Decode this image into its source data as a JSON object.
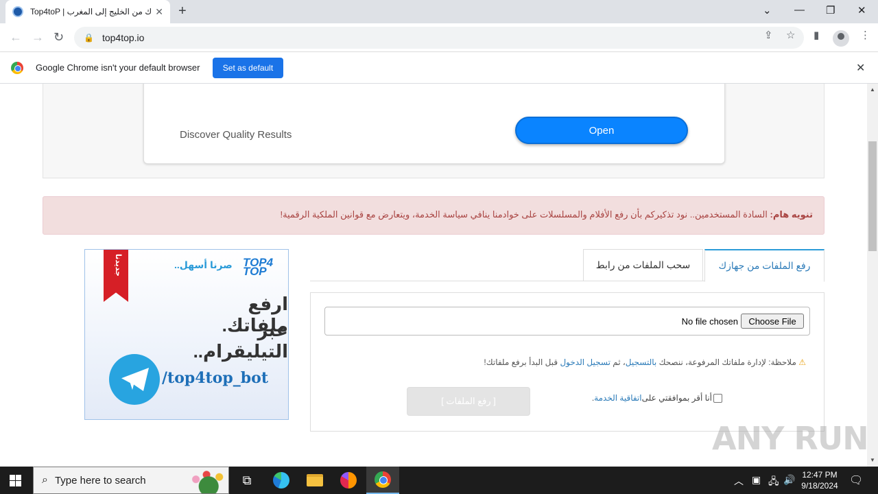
{
  "browser": {
    "tab_title": "Top4toP | ك من الخليج إلى المغرب",
    "tab_close": "✕",
    "new_tab": "+",
    "url": "top4top.io",
    "window_controls": {
      "dropdown": "⌄",
      "minimize": "—",
      "restore": "❐",
      "close": "✕"
    }
  },
  "infobar": {
    "message": "Google Chrome isn't your default browser",
    "button": "Set as default",
    "close": "✕"
  },
  "ad": {
    "text": "Discover Quality Results",
    "button": "Open"
  },
  "alert": {
    "bold": "تنويه هام:",
    "text": " السادة المستخدمين.. نود تذكيركم بأن رفع الأفلام والمسلسلات على خوادمنا ينافي سياسة الخدمة، ويتعارض مع قوانين الملكية الرقمية!"
  },
  "promo": {
    "ribbon": "جديدنا",
    "logo_top": "TOP4",
    "logo_bottom": "TOP",
    "slogan": "صرنا أسهل..",
    "line1": "ارفع ملفاتك.",
    "line2": "عبر التيليقرام..",
    "handle": "/top4top_bot"
  },
  "upload": {
    "tabs": [
      "رفع الملفات من جهازك",
      "سحب الملفات من رابط"
    ],
    "file_status": "No file chosen",
    "choose_file": "Choose File",
    "note_prefix": "ملاحظة: لإدارة ملفاتك المرفوعة، ننصحك ",
    "note_register": "بالتسجيل",
    "note_mid": "، ثم ",
    "note_login": "تسجيل الدخول",
    "note_suffix": " قبل البدأ برفع ملفاتك!",
    "agree_prefix": "أنا أقر بموافقتي على ",
    "agree_link": "اتفاقية الخدمة",
    "agree_suffix": ".",
    "upload_button": "[ رفع الملفات ]"
  },
  "watermark": "ANY RUN",
  "taskbar": {
    "search_placeholder": "Type here to search",
    "time": "12:47 PM",
    "date": "9/18/2024"
  }
}
